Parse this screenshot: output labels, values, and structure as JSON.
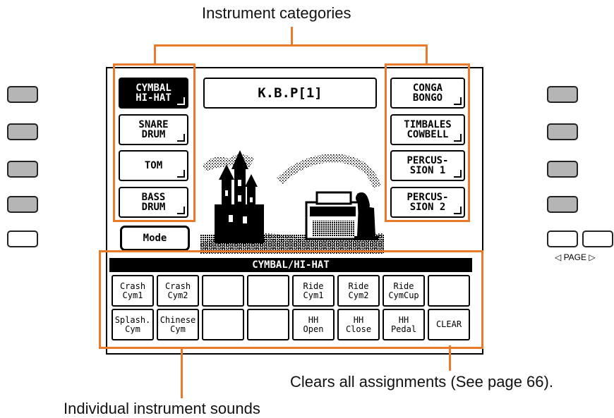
{
  "callouts": {
    "categories": "Instrument categories",
    "clear": "Clears all assignments (See page 66).",
    "sounds": "Individual instrument sounds"
  },
  "screen_title": "K.B.P[1]",
  "left_categories": [
    "CYMBAL\nHI-HAT",
    "SNARE\nDRUM",
    "TOM",
    "BASS\nDRUM"
  ],
  "right_categories": [
    "CONGA\nBONGO",
    "TIMBALES\nCOWBELL",
    "PERCUS-\nSION 1",
    "PERCUS-\nSION 2"
  ],
  "mode_label": "Mode",
  "section_title": "CYMBAL/HI-HAT",
  "sounds_row1": [
    "Crash\nCym1",
    "Crash\nCym2",
    "",
    "",
    "Ride\nCym1",
    "Ride\nCym2",
    "Ride\nCymCup",
    ""
  ],
  "sounds_row2": [
    "Splash.\nCym",
    "Chinese\nCym",
    "",
    "",
    "HH\nOpen",
    "HH\nClose",
    "HH\nPedal",
    "CLEAR"
  ],
  "page_label": "◁ PAGE ▷",
  "colors": {
    "callout_outline": "#e87a2a",
    "button_gray": "#b5b5b5"
  }
}
